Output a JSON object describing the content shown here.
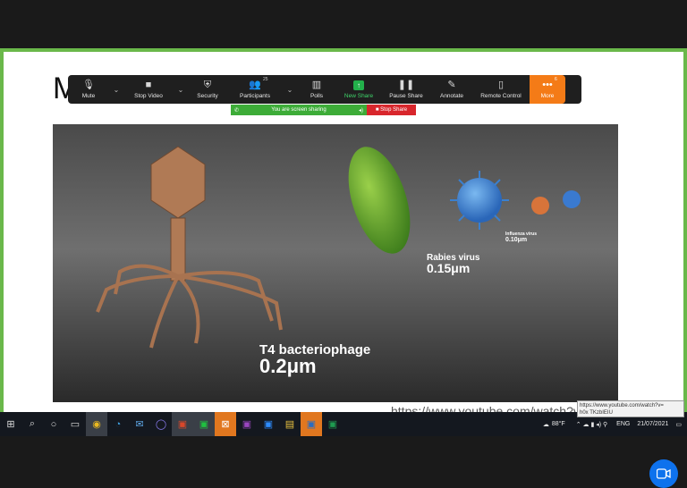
{
  "slide": {
    "title_visible": "M"
  },
  "toolbar": {
    "items": [
      {
        "label": "Mute",
        "icon": "microphone-icon"
      },
      {
        "label": "Stop Video",
        "icon": "video-camera-icon"
      },
      {
        "label": "Security",
        "icon": "shield-icon"
      },
      {
        "label": "Participants",
        "icon": "participants-icon",
        "count": "25"
      },
      {
        "label": "Polls",
        "icon": "bar-chart-icon"
      },
      {
        "label": "New Share",
        "icon": "share-arrow-icon"
      },
      {
        "label": "Pause Share",
        "icon": "pause-icon"
      },
      {
        "label": "Annotate",
        "icon": "pencil-icon"
      },
      {
        "label": "Remote Control",
        "icon": "mouse-icon"
      },
      {
        "label": "More",
        "icon": "ellipsis-icon",
        "badge": "6"
      }
    ],
    "accent_color": "#f47b17"
  },
  "share_bar": {
    "message": "You are screen sharing",
    "stop_label": "Stop Share"
  },
  "video": {
    "labels": [
      {
        "name": "T4 bacteriophage",
        "size": "0.2μm"
      },
      {
        "name": "Rabies virus",
        "size": "0.15μm"
      },
      {
        "name": "Influenza virus",
        "size": "0.10μm"
      }
    ]
  },
  "link_url": "https://www.youtube.com/watch?v",
  "tooltip": {
    "line1": "https://www.youtube.com/watch?v=",
    "line2": "h0x TKzbIEIU"
  },
  "tray": {
    "temperature": "88°F",
    "lang": "ENG",
    "date": "21/07/2021"
  }
}
